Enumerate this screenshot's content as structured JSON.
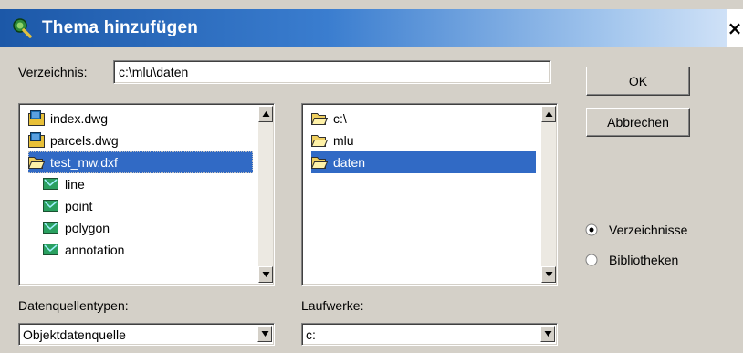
{
  "window": {
    "title": "Thema hinzufügen",
    "close_glyph": "×"
  },
  "directory": {
    "label": "Verzeichnis:",
    "value": "c:\\mlu\\daten"
  },
  "buttons": {
    "ok": "OK",
    "cancel": "Abbrechen"
  },
  "theme_list": {
    "items": [
      {
        "label": "index.dwg",
        "icon": "cad-drawing-icon"
      },
      {
        "label": "parcels.dwg",
        "icon": "cad-drawing-icon"
      },
      {
        "label": "test_mw.dxf",
        "icon": "open-folder-icon",
        "selected": true
      },
      {
        "label": "line",
        "icon": "feature-class-icon"
      },
      {
        "label": "point",
        "icon": "feature-class-icon"
      },
      {
        "label": "polygon",
        "icon": "feature-class-icon"
      },
      {
        "label": "annotation",
        "icon": "feature-class-icon"
      }
    ]
  },
  "folder_list": {
    "items": [
      {
        "label": "c:\\",
        "icon": "open-folder-icon"
      },
      {
        "label": "mlu",
        "icon": "open-folder-icon"
      },
      {
        "label": "daten",
        "icon": "open-folder-icon",
        "selected": true
      }
    ]
  },
  "source_types": {
    "label": "Datenquellentypen:",
    "value": "Objektdatenquelle"
  },
  "drives": {
    "label": "Laufwerke:",
    "value": "c:"
  },
  "view_mode": {
    "options": [
      {
        "label": "Verzeichnisse",
        "checked": true
      },
      {
        "label": "Bibliotheken",
        "checked": false
      }
    ]
  },
  "colors": {
    "selection": "#316ac5",
    "dialog_bg": "#d4d0c8",
    "title_bar": "#1c58a8"
  }
}
